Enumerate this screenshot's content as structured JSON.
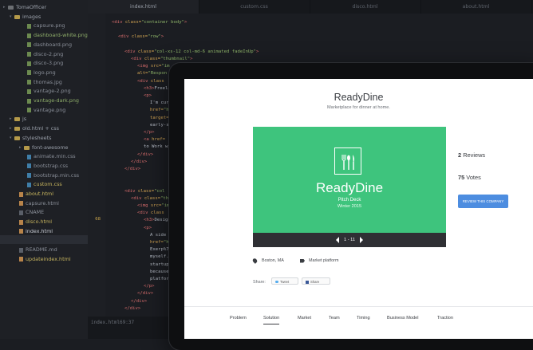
{
  "editor": {
    "tree": [
      {
        "label": "TomaOfficer",
        "kind": "root"
      },
      {
        "label": "images",
        "kind": "folder-open"
      },
      {
        "label": "capsure.png",
        "kind": "img"
      },
      {
        "label": "dashboard-white.png",
        "kind": "img-green"
      },
      {
        "label": "dashboard.png",
        "kind": "img"
      },
      {
        "label": "disco-2.png",
        "kind": "img"
      },
      {
        "label": "disco-3.png",
        "kind": "img"
      },
      {
        "label": "logo.png",
        "kind": "img"
      },
      {
        "label": "thomas.jpg",
        "kind": "img"
      },
      {
        "label": "vantage-2.png",
        "kind": "img"
      },
      {
        "label": "vantage-dark.png",
        "kind": "img-green"
      },
      {
        "label": "vantage.png",
        "kind": "img"
      },
      {
        "label": "js",
        "kind": "folder"
      },
      {
        "label": "old.html + css",
        "kind": "folder"
      },
      {
        "label": "stylesheets",
        "kind": "folder-open"
      },
      {
        "label": "font-awesome",
        "kind": "folder"
      },
      {
        "label": "animate.min.css",
        "kind": "css"
      },
      {
        "label": "bootstrap.css",
        "kind": "css"
      },
      {
        "label": "bootstrap.min.css",
        "kind": "css"
      },
      {
        "label": "custom.css",
        "kind": "css-yellow"
      },
      {
        "label": "about.html",
        "kind": "html-yellow"
      },
      {
        "label": "capsure.html",
        "kind": "html"
      },
      {
        "label": "CNAME",
        "kind": "file"
      },
      {
        "label": "disco.html",
        "kind": "html-yellow"
      },
      {
        "label": "index.html",
        "kind": "html-yellow"
      },
      {
        "label": "juesold-index.html",
        "kind": "html-yellow"
      },
      {
        "label": "README.md",
        "kind": "file"
      },
      {
        "label": "updateindex.html",
        "kind": "html-yellow"
      }
    ],
    "tabs": [
      "index.html",
      "custom.css",
      "disco.html",
      "about.html"
    ],
    "active_tab": 0,
    "highlight_line": "68",
    "lines": [
      {
        "n": "",
        "i": 0,
        "parts": [
          [
            "tg",
            "<div"
          ],
          [
            "at",
            " class="
          ],
          [
            "st",
            "\"container body\""
          ],
          [
            "tg",
            ">"
          ]
        ]
      },
      {
        "n": "",
        "i": 0,
        "parts": []
      },
      {
        "n": "",
        "i": 1,
        "parts": [
          [
            "tg",
            "<div"
          ],
          [
            "at",
            " class="
          ],
          [
            "st",
            "\"row\""
          ],
          [
            "tg",
            ">"
          ]
        ]
      },
      {
        "n": "",
        "i": 0,
        "parts": []
      },
      {
        "n": "",
        "i": 2,
        "parts": [
          [
            "tg",
            "<div"
          ],
          [
            "at",
            " class="
          ],
          [
            "st",
            "\"col-xs-12 col-md-6 animated fadeInUp\""
          ],
          [
            "tg",
            ">"
          ]
        ]
      },
      {
        "n": "",
        "i": 3,
        "parts": [
          [
            "tg",
            "<div"
          ],
          [
            "at",
            " class="
          ],
          [
            "st",
            "\"thumbnail\""
          ],
          [
            "tg",
            ">"
          ]
        ]
      },
      {
        "n": "",
        "i": 4,
        "parts": [
          [
            "tg",
            "<img"
          ],
          [
            "at",
            " src="
          ],
          [
            "st",
            "\"im"
          ]
        ]
      },
      {
        "n": "",
        "i": 4,
        "parts": [
          [
            "at",
            "alt="
          ],
          [
            "st",
            "\"Respon"
          ]
        ]
      },
      {
        "n": "",
        "i": 4,
        "parts": [
          [
            "tg",
            "<div"
          ],
          [
            "at",
            " class"
          ]
        ]
      },
      {
        "n": "",
        "i": 5,
        "parts": [
          [
            "tg",
            "<h3>"
          ],
          [
            "tx",
            "Freela"
          ]
        ]
      },
      {
        "n": "",
        "i": 5,
        "parts": [
          [
            "tg",
            "<p>"
          ]
        ]
      },
      {
        "n": "",
        "i": 6,
        "parts": [
          [
            "tx",
            "I'm curr"
          ]
        ]
      },
      {
        "n": "",
        "i": 6,
        "parts": [
          [
            "at",
            "href="
          ],
          [
            "st",
            "\"h"
          ]
        ]
      },
      {
        "n": "",
        "i": 6,
        "parts": [
          [
            "at",
            "target="
          ]
        ]
      },
      {
        "n": "",
        "i": 6,
        "parts": [
          [
            "tx",
            "early-st"
          ]
        ]
      },
      {
        "n": "",
        "i": 5,
        "parts": [
          [
            "tg",
            "</p>"
          ]
        ]
      },
      {
        "n": "",
        "i": 5,
        "parts": [
          [
            "tg",
            "<a"
          ],
          [
            "at",
            " href="
          ]
        ]
      },
      {
        "n": "",
        "i": 5,
        "parts": [
          [
            "tx",
            "to Work wi"
          ]
        ]
      },
      {
        "n": "",
        "i": 4,
        "parts": [
          [
            "tg",
            "</div>"
          ]
        ]
      },
      {
        "n": "",
        "i": 3,
        "parts": [
          [
            "tg",
            "</div>"
          ]
        ]
      },
      {
        "n": "",
        "i": 2,
        "parts": [
          [
            "tg",
            "</div>"
          ]
        ]
      },
      {
        "n": "",
        "i": 0,
        "parts": []
      },
      {
        "n": "",
        "i": 0,
        "parts": []
      },
      {
        "n": "",
        "i": 2,
        "parts": [
          [
            "tg",
            "<div"
          ],
          [
            "at",
            " class="
          ],
          [
            "st",
            "\"col"
          ]
        ]
      },
      {
        "n": "",
        "i": 3,
        "parts": [
          [
            "tg",
            "<div"
          ],
          [
            "at",
            " class="
          ],
          [
            "st",
            "\"th"
          ]
        ]
      },
      {
        "n": "",
        "i": 4,
        "parts": [
          [
            "tg",
            "<img"
          ],
          [
            "at",
            " src="
          ],
          [
            "st",
            "\"im"
          ]
        ]
      },
      {
        "n": "",
        "i": 4,
        "parts": [
          [
            "tg",
            "<div"
          ],
          [
            "at",
            " class"
          ]
        ]
      },
      {
        "n": "68",
        "i": 5,
        "parts": [
          [
            "tg",
            "<h3>"
          ],
          [
            "tx",
            "Design"
          ]
        ]
      },
      {
        "n": "",
        "i": 5,
        "parts": [
          [
            "tg",
            "<p>"
          ]
        ]
      },
      {
        "n": "",
        "i": 6,
        "parts": [
          [
            "tx",
            "A side p"
          ]
        ]
      },
      {
        "n": "",
        "i": 6,
        "parts": [
          [
            "at",
            "href="
          ],
          [
            "st",
            "\"ht"
          ]
        ]
      },
      {
        "n": "",
        "i": 6,
        "parts": [
          [
            "tx",
            "Exerp%7C"
          ]
        ]
      },
      {
        "n": "",
        "i": 6,
        "parts": [
          [
            "tx",
            "myself."
          ]
        ]
      },
      {
        "n": "",
        "i": 6,
        "parts": [
          [
            "tx",
            "startups"
          ]
        ]
      },
      {
        "n": "",
        "i": 6,
        "parts": [
          [
            "tx",
            "because"
          ]
        ]
      },
      {
        "n": "",
        "i": 6,
        "parts": [
          [
            "tx",
            "platform"
          ]
        ]
      },
      {
        "n": "",
        "i": 5,
        "parts": [
          [
            "tg",
            "</p>"
          ]
        ]
      },
      {
        "n": "",
        "i": 4,
        "parts": [
          [
            "tg",
            "</div>"
          ]
        ]
      },
      {
        "n": "",
        "i": 3,
        "parts": [
          [
            "tg",
            "</div>"
          ]
        ]
      },
      {
        "n": "",
        "i": 2,
        "parts": [
          [
            "tg",
            "</div>"
          ]
        ]
      }
    ],
    "status": {
      "file": "index.html",
      "position": "69:37"
    }
  },
  "site": {
    "title": "ReadyDine",
    "subtitle": "Marketplace for dinner at home.",
    "hero": {
      "name": "ReadyDine",
      "deck": "Pitch Deck",
      "season": "Winter 2015",
      "bg": "#3ec47d"
    },
    "pager": "1 - 11",
    "reviews_count": "2",
    "reviews_label": "Reviews",
    "votes_count": "75",
    "votes_label": "Votes",
    "cta_label": "REVIEW THIS COMPANY",
    "location": "Boston, MA",
    "category": "Market platform",
    "share_label": "Share:",
    "tweet_label": "Tweet",
    "fb_share_label": "Share",
    "nav": [
      "Problem",
      "Solution",
      "Market",
      "Team",
      "Timing",
      "Business Model",
      "Traction"
    ],
    "nav_active": 1
  },
  "colors": {
    "accent_green": "#3ec47d",
    "cta_blue": "#4d8de0"
  }
}
